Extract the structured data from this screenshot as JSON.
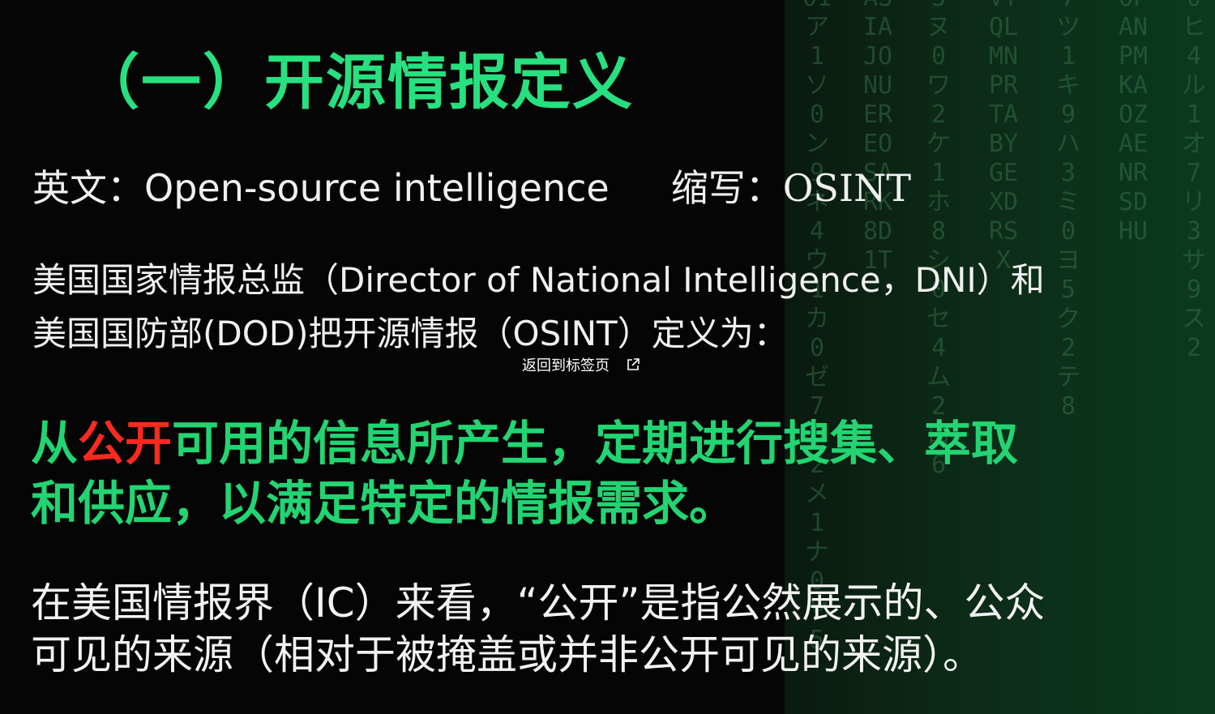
{
  "slide": {
    "title": "（一）开源情报定义",
    "english": {
      "label": "英文：",
      "value": "Open-source intelligence",
      "abbr_label": "缩写：",
      "abbr_value": "OSINT"
    },
    "definition_intro": {
      "line1": "美国国家情报总监（Director of National Intelligence，DNI）和",
      "line2": "美国国防部(DOD)把开源情报（OSINT）定义为："
    },
    "definition": {
      "line1_pre": "从",
      "line1_red": "公开",
      "line1_post": "可用的信息所产生，定期进行搜集、萃取",
      "line2": "和供应，以满足特定的情报需求。"
    },
    "ic_note": {
      "line1": "在美国情报界（IC）来看，“公开”是指公然展示的、公众",
      "line2": "可见的来源（相对于被掩盖或并非公开可见的来源）。"
    },
    "colors": {
      "title_green": "#27e07f",
      "definition_green": "#22d572",
      "highlight_red": "#ff2a1d",
      "body_white": "#f0f0f0"
    }
  },
  "overlay": {
    "back_to_tab_label": "返回到标签页",
    "icon": "external-link-icon"
  }
}
